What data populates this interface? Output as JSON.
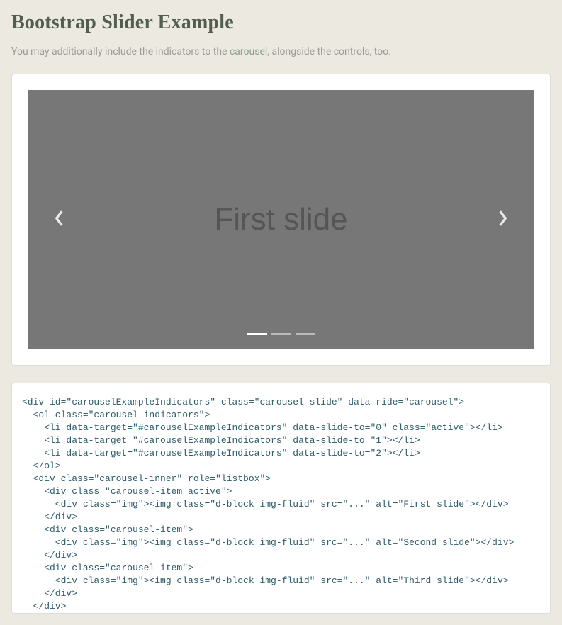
{
  "header": {
    "title": "Bootstrap Slider Example",
    "intro_pre": "You may additionally include the indicators to the ",
    "intro_link": "carousel",
    "intro_post": ", alongside the controls, too."
  },
  "carousel": {
    "slide_label": "First slide",
    "indicators": [
      {
        "active": true
      },
      {
        "active": false
      },
      {
        "active": false
      }
    ]
  },
  "code": "<div id=\"carouselExampleIndicators\" class=\"carousel slide\" data-ride=\"carousel\">\n  <ol class=\"carousel-indicators\">\n    <li data-target=\"#carouselExampleIndicators\" data-slide-to=\"0\" class=\"active\"></li>\n    <li data-target=\"#carouselExampleIndicators\" data-slide-to=\"1\"></li>\n    <li data-target=\"#carouselExampleIndicators\" data-slide-to=\"2\"></li>\n  </ol>\n  <div class=\"carousel-inner\" role=\"listbox\">\n    <div class=\"carousel-item active\">\n      <div class=\"img\"><img class=\"d-block img-fluid\" src=\"...\" alt=\"First slide\"></div>\n    </div>\n    <div class=\"carousel-item\">\n      <div class=\"img\"><img class=\"d-block img-fluid\" src=\"...\" alt=\"Second slide\"></div>\n    </div>\n    <div class=\"carousel-item\">\n      <div class=\"img\"><img class=\"d-block img-fluid\" src=\"...\" alt=\"Third slide\"></div>\n    </div>\n  </div>"
}
